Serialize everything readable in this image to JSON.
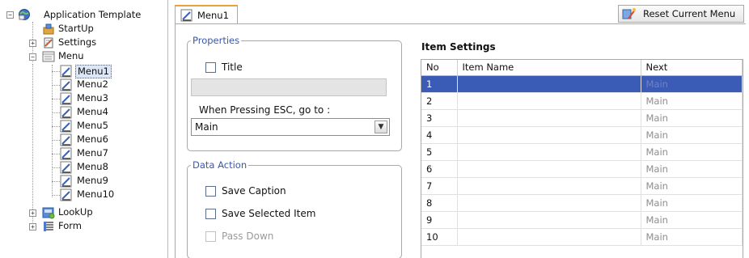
{
  "tree": {
    "root": "Application Template",
    "items": [
      {
        "label": "StartUp"
      },
      {
        "label": "Settings"
      },
      {
        "label": "Menu"
      },
      {
        "label": "Menu1"
      },
      {
        "label": "Menu2"
      },
      {
        "label": "Menu3"
      },
      {
        "label": "Menu4"
      },
      {
        "label": "Menu5"
      },
      {
        "label": "Menu6"
      },
      {
        "label": "Menu7"
      },
      {
        "label": "Menu8"
      },
      {
        "label": "Menu9"
      },
      {
        "label": "Menu10"
      },
      {
        "label": "LookUp"
      },
      {
        "label": "Form"
      }
    ],
    "selected": "Menu1",
    "expander_collapsed": "+",
    "expander_expanded": "−"
  },
  "tab": {
    "label": "Menu1",
    "icon": "menu-page-icon"
  },
  "reset_button": {
    "label": "Reset Current Menu",
    "icon": "reset-wand-icon"
  },
  "properties": {
    "legend": "Properties",
    "title_label": "Title",
    "title_checked": false,
    "title_value": "",
    "esc_label": "When Pressing ESC, go to  :",
    "esc_value": "Main"
  },
  "data_action": {
    "legend": "Data Action",
    "save_caption": "Save Caption",
    "save_selected": "Save Selected Item",
    "pass_down": "Pass Down"
  },
  "item_settings": {
    "title": "Item Settings",
    "columns": [
      "No",
      "Item Name",
      "Next"
    ],
    "rows": [
      {
        "no": "1",
        "name": "",
        "next": "Main"
      },
      {
        "no": "2",
        "name": "",
        "next": "Main"
      },
      {
        "no": "3",
        "name": "",
        "next": "Main"
      },
      {
        "no": "4",
        "name": "",
        "next": "Main"
      },
      {
        "no": "5",
        "name": "",
        "next": "Main"
      },
      {
        "no": "6",
        "name": "",
        "next": "Main"
      },
      {
        "no": "7",
        "name": "",
        "next": "Main"
      },
      {
        "no": "8",
        "name": "",
        "next": "Main"
      },
      {
        "no": "9",
        "name": "",
        "next": "Main"
      },
      {
        "no": "10",
        "name": "",
        "next": "Main"
      }
    ],
    "selected_row": 1
  },
  "colors": {
    "accent": "#3a5bb6",
    "legend": "#3b58a8",
    "tab_top": "#e8a23b"
  }
}
